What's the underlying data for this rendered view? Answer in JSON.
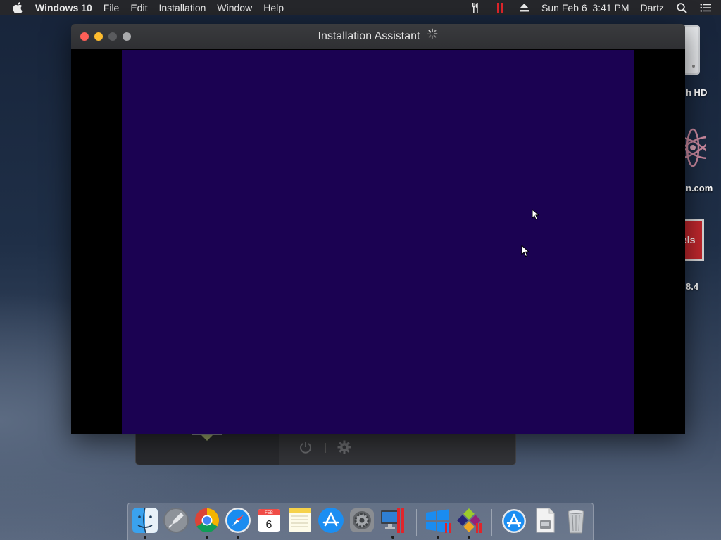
{
  "menubar": {
    "apple_icon": "apple-icon",
    "app_name": "Windows 10",
    "menus": [
      "File",
      "Edit",
      "Installation",
      "Window",
      "Help"
    ],
    "status_icons": [
      "parallels-tools-icon",
      "parallels-pause-icon",
      "eject-icon"
    ],
    "datetime": "Sun Feb 6  3:41 PM",
    "user": "Dartz",
    "right_icons": [
      "search-icon",
      "list-icon"
    ]
  },
  "desktop": {
    "labels": [
      "h HD",
      "n.com",
      "8.4"
    ]
  },
  "window": {
    "title": "Installation Assistant",
    "screen_color": "#1b0252"
  },
  "control_panel": {
    "icons": [
      "power-icon",
      "gear-icon"
    ]
  },
  "dock": {
    "items": [
      "finder-icon",
      "launchpad-icon",
      "chrome-icon",
      "safari-icon",
      "calendar-icon",
      "notes-icon",
      "app-store-icon",
      "system-preferences-icon",
      "parallels-desktop-icon",
      "windows-10-icon",
      "centos-icon",
      "app-store-download-icon",
      "document-icon",
      "trash-icon"
    ],
    "calendar_month": "FEB",
    "calendar_day": "6"
  }
}
